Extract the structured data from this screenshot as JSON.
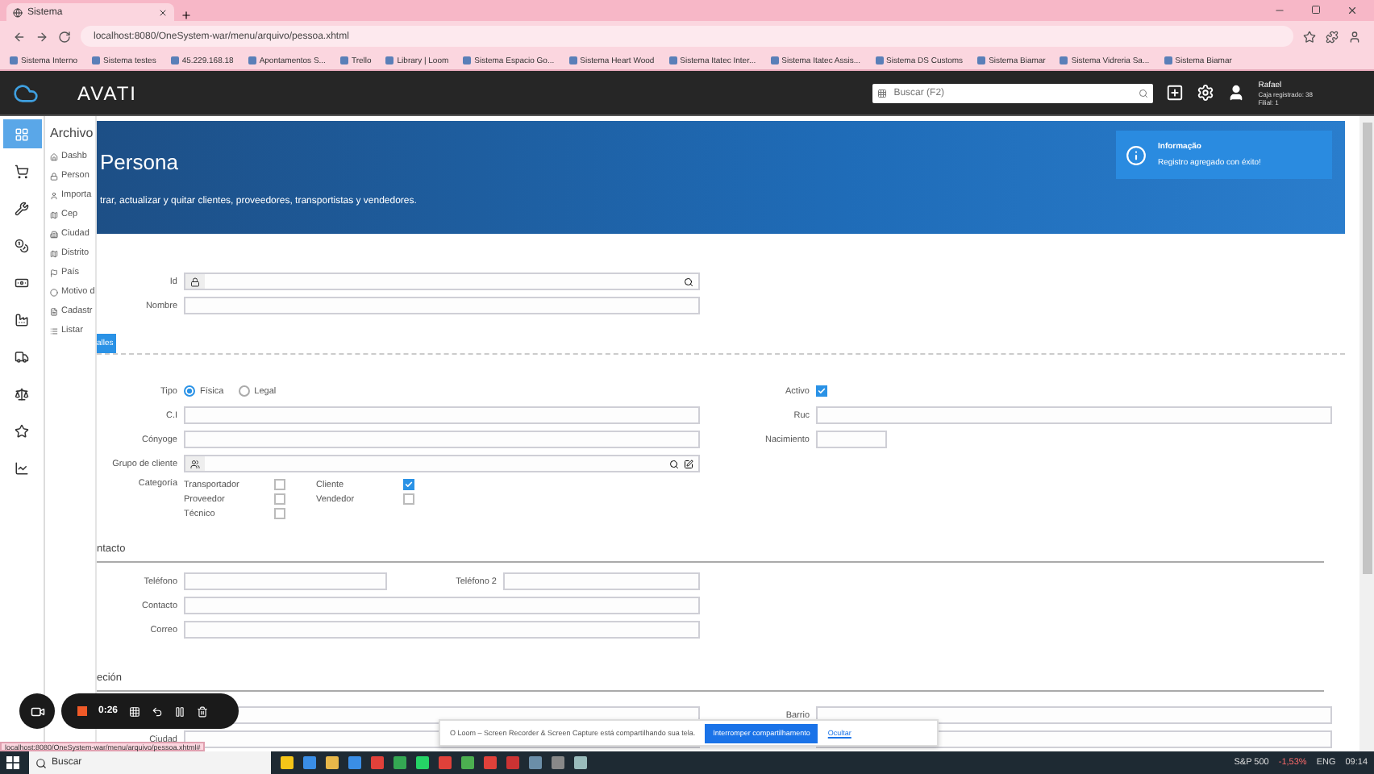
{
  "browser": {
    "tab_title": "Sistema",
    "url": "localhost:8080/OneSystem-war/menu/arquivo/pessoa.xhtml",
    "bookmarks": [
      {
        "label": "Sistema Interno"
      },
      {
        "label": "Sistema testes"
      },
      {
        "label": "45.229.168.18"
      },
      {
        "label": "Apontamentos S..."
      },
      {
        "label": "Trello"
      },
      {
        "label": "Library | Loom"
      },
      {
        "label": "Sistema Espacio Go..."
      },
      {
        "label": "Sistema Heart Wood"
      },
      {
        "label": "Sistema Itatec Inter..."
      },
      {
        "label": "Sistema Itatec Assis..."
      },
      {
        "label": "Sistema DS Customs"
      },
      {
        "label": "Sistema Biamar"
      },
      {
        "label": "Sistema Vidreria Sa..."
      },
      {
        "label": "Sistema Biamar"
      }
    ]
  },
  "app_header": {
    "logo": "AVATI",
    "search": {
      "placeholder": "Buscar (F2)"
    },
    "user": {
      "name": "Rafael",
      "lines": [
        "Caja registrado: 38",
        "Filial: 1"
      ]
    }
  },
  "rail": [
    {
      "kind": "grid",
      "selected": true
    },
    {
      "kind": "cart",
      "selected": false
    },
    {
      "kind": "wrench",
      "selected": false
    },
    {
      "kind": "coins",
      "selected": false
    },
    {
      "kind": "money",
      "selected": false
    },
    {
      "kind": "factory",
      "selected": false
    },
    {
      "kind": "truck",
      "selected": false
    },
    {
      "kind": "scale",
      "selected": false
    },
    {
      "kind": "star",
      "selected": false
    },
    {
      "kind": "chart",
      "selected": false
    }
  ],
  "menu": {
    "title": "Archivo",
    "items": [
      {
        "kind": "home",
        "label": "Dashb"
      },
      {
        "kind": "lock",
        "label": "Person"
      },
      {
        "kind": "user",
        "label": "Importa"
      },
      {
        "kind": "map",
        "label": "Cep"
      },
      {
        "kind": "building",
        "label": "Ciudad"
      },
      {
        "kind": "map",
        "label": "Distrito"
      },
      {
        "kind": "flag",
        "label": "País"
      },
      {
        "kind": "dot",
        "label": "Motivo d"
      },
      {
        "kind": "file",
        "label": "Cadastr"
      },
      {
        "kind": "list",
        "label": "Listar"
      }
    ]
  },
  "page": {
    "title": "Persona",
    "subtitle": "trar, actualizar y quitar clientes, proveedores, transportistas y vendedores."
  },
  "toast": {
    "title": "Informação",
    "message": "Registro agregado con éxito!"
  },
  "form": {
    "top_rows": [
      {
        "left": {
          "label": "Id",
          "kind": "lookup"
        }
      },
      {
        "left": {
          "label": "Nombre",
          "kind": "text"
        }
      }
    ],
    "tab_button": "alles",
    "tipo": {
      "label": "Tipo",
      "options": [
        {
          "label": "Física",
          "selected": true
        },
        {
          "label": "Legal",
          "selected": false
        }
      ]
    },
    "activo": {
      "label": "Activo",
      "checked": true
    },
    "detail_rows": [
      {
        "left": {
          "label": "C.I",
          "kind": "text"
        },
        "right": {
          "label": "Ruc",
          "kind": "text"
        }
      },
      {
        "left": {
          "label": "Cónyoge",
          "kind": "text"
        },
        "right": {
          "label": "Nacimiento",
          "kind": "date"
        }
      },
      {
        "left": {
          "label": "Grupo de cliente",
          "kind": "group"
        }
      }
    ],
    "categoria": {
      "label": "Categoría",
      "options": [
        {
          "label": "Transportador",
          "checked": false
        },
        {
          "label": "Cliente",
          "checked": true
        },
        {
          "label": "Proveedor",
          "checked": false
        },
        {
          "label": "Vendedor",
          "checked": false
        },
        {
          "label": "Técnico",
          "checked": false
        }
      ]
    },
    "contact": {
      "heading": "ntacto",
      "rows": [
        {
          "kind": "pair",
          "fields": [
            {
              "label": "Teléfono"
            },
            {
              "label": "Teléfono 2"
            }
          ]
        },
        {
          "kind": "single",
          "left": {
            "label": "Contacto",
            "kind": "text"
          }
        },
        {
          "kind": "single",
          "left": {
            "label": "Correo",
            "kind": "text"
          }
        }
      ]
    },
    "address": {
      "heading": "eción",
      "rows": [
        {
          "left": {
            "kind": "text"
          },
          "right": {
            "label": "Barrio",
            "kind": "text"
          }
        },
        {
          "left": {
            "label": "Ciudad",
            "kind": "text"
          },
          "right": {
            "kind": "text"
          }
        }
      ]
    }
  },
  "loom_controls": {
    "timer": "0:26"
  },
  "loom_bar": {
    "message": "O Loom – Screen Recorder & Screen Capture está compartilhando sua tela.",
    "button": "Interromper compartilhamento",
    "link": "Ocultar"
  },
  "status_url": "localhost:8080/OneSystem-war/menu/arquivo/pessoa.xhtml#",
  "taskbar": {
    "search": "Buscar",
    "stock": "S&P 500",
    "change": "-1,53%",
    "lang": "ENG",
    "time": "09:14"
  }
}
